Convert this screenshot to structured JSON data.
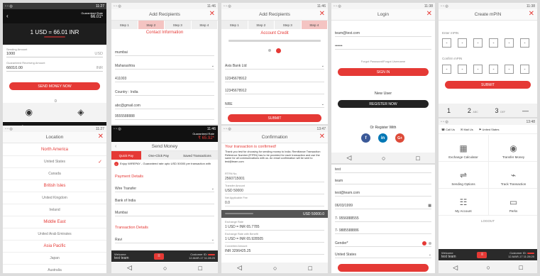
{
  "nav": {
    "back": "◁",
    "home": "○",
    "recent": "□"
  },
  "p1": {
    "time": "11:27",
    "rate_label": "Guaranteed Rate",
    "rate": "66.01*",
    "conversion": "1 USD = 66.01 INR",
    "send_label": "Sending Amount",
    "send_value": "1000",
    "send_cur": "USD",
    "recv_label": "Guaranteed Receiving Amount",
    "recv_value": "66010.00",
    "recv_cur": "INR",
    "cta": "SEND MONEY NOW",
    "badge": "0"
  },
  "p2": {
    "time": "11:46",
    "title": "Add Recipients",
    "steps": [
      "Step 1",
      "Step 2",
      "Step 3",
      "Step 4"
    ],
    "section": "Contact Information",
    "fields": [
      "mumbai",
      "Maharashtra",
      "411003",
      "Country : India",
      "abc@gmail.com",
      "9555588888"
    ]
  },
  "p3": {
    "time": "11:46",
    "title": "Add Recipients",
    "steps": [
      "Step 1",
      "Step 2",
      "Step 3",
      "Step 4"
    ],
    "section": "Account Credit",
    "fields": [
      "Axis Bank Ltd",
      "12345678912",
      "12345678912",
      "NRE"
    ],
    "cta": "SUBMIT"
  },
  "p4": {
    "time": "11:38",
    "title": "Login",
    "email": "team@test.com",
    "password": "••••••",
    "forgot": "Forgot Password/Forgot Username",
    "signin": "SIGN IN",
    "new_user": "New User",
    "register": "REGISTER NOW",
    "or": "Or Register With",
    "social": [
      "f",
      "in",
      "G+"
    ]
  },
  "p5": {
    "time": "11:38",
    "title": "Create mPIN",
    "enter": "Enter mPIN",
    "confirm": "Confirm mPIN",
    "pin": [
      "-",
      "-",
      "-",
      "-",
      "-",
      "-"
    ],
    "cta": "SUBMIT",
    "keys": [
      "1",
      "2",
      "3",
      "—"
    ],
    "keysub": [
      "",
      "ABC",
      "DEF",
      ""
    ]
  },
  "p6": {
    "time": "11:27",
    "title": "Location",
    "items": [
      {
        "t": "North America",
        "h": true
      },
      {
        "t": "United States",
        "h": false
      },
      {
        "t": "Canada",
        "h": false
      },
      {
        "t": "British Isles",
        "h": true
      },
      {
        "t": "United Kingdom",
        "h": false
      },
      {
        "t": "Ireland",
        "h": false
      },
      {
        "t": "Middle East",
        "h": true
      },
      {
        "t": "United Arab Emirates",
        "h": false
      },
      {
        "t": "Asia Pacific",
        "h": true
      },
      {
        "t": "Japan",
        "h": false
      },
      {
        "t": "Australia",
        "h": false
      }
    ]
  },
  "p7": {
    "time": "11:46",
    "rate_label": "Guaranteed Rate",
    "rate": "65.92*",
    "title": "Send Money",
    "tabs": [
      "Quick Pay",
      "One-Click Pay",
      "Saved Transactions"
    ],
    "promo": "Enjoy WIREPAY - Guaranteed rate upto USD 50000 per transaction with",
    "pd": "Payment Details",
    "fields": [
      "Wire Transfer",
      "Bank of India",
      "Mumbai"
    ],
    "td": "Transaction Details",
    "td_value": "Ravi",
    "welcome": "Welcome",
    "user": "test team",
    "cust": "Customer ID:",
    "date": "12-MAR-17 11:28:20"
  },
  "p8": {
    "time": "13:47",
    "title": "Confirmation",
    "heading": "Your transaction is confirmed!",
    "body": "Thank you test for choosing for sending money to India. Remittance Transaction Reference Number (RTRN) has to be provided for each transaction and use the same for all communications with us. An email confirmation will be sent to test@team.com",
    "items": [
      {
        "l": "RTRN No.",
        "v": "2560715001"
      },
      {
        "l": "Transfer Amount",
        "v": "USD 50000"
      },
      {
        "l": "Net Applicable Fee",
        "v": "0.0"
      }
    ],
    "total": "USD 50000.0",
    "items2": [
      {
        "l": "Exchange Rate",
        "v": "1 USD = INR 65.7785"
      },
      {
        "l": "Exchange Rate with Benefit",
        "v": "1 USD = INR 65.928505"
      },
      {
        "l": "Converted Amount",
        "v": "INR 3296425.25"
      }
    ]
  },
  "p9": {
    "fields": [
      "test",
      "team",
      "test@team.com",
      "06/03/1999",
      "9556888555",
      "9885588886"
    ],
    "gender": "Gender*",
    "country": "United States",
    "pref1": "7-",
    "pref2": "7-"
  },
  "p10": {
    "time": "13:48",
    "tabs": [
      "Call Us",
      "Mail Us",
      "United States"
    ],
    "tiles": [
      "Exchange Calculator",
      "Transfer Money",
      "Sending Options",
      "Track Transaction",
      "My Account",
      "Perks"
    ],
    "logout": "LOGOUT",
    "welcome": "Welcome",
    "user": "test team",
    "cust": "Customer ID:",
    "date": "12-MAR-17 11:28:20"
  },
  "colors": {
    "accent": "#e53935",
    "dark": "#1e1e1e"
  }
}
